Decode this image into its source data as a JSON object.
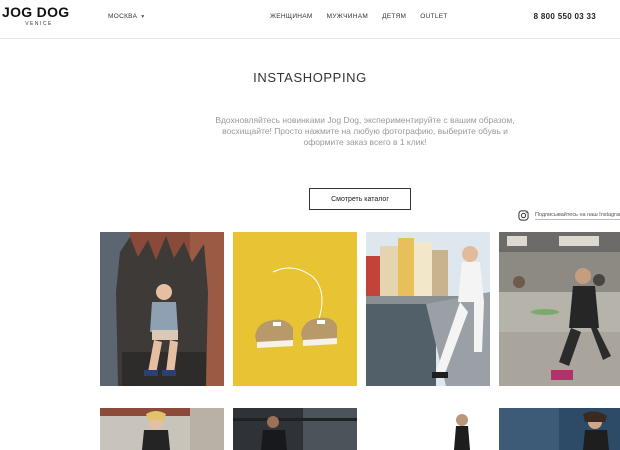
{
  "header": {
    "logo_main": "JOG DOG",
    "logo_sub": "VENICE",
    "city": "МОСКВА",
    "nav": [
      "ЖЕНЩИНАМ",
      "МУЖЧИНАМ",
      "ДЕТЯМ",
      "OUTLET"
    ],
    "phone": "8 800 550 03 33"
  },
  "main": {
    "title": "INSTASHOPPING",
    "description": "Вдохновляйтесь новинками Jog Dog, экспериментируйте с вашим образом, восхищайте! Просто нажмите на любую фотографию, выберите обувь и оформите заказ всего в 1 клик!",
    "catalog_button": "Смотреть каталог",
    "instagram_link": "Подписывайтесь на наш Instagram"
  },
  "colors": {
    "text": "#333333",
    "muted": "#999999",
    "sneaker_background": "#e8c435"
  },
  "icons": [
    "chevron-down-icon",
    "instagram-icon"
  ]
}
